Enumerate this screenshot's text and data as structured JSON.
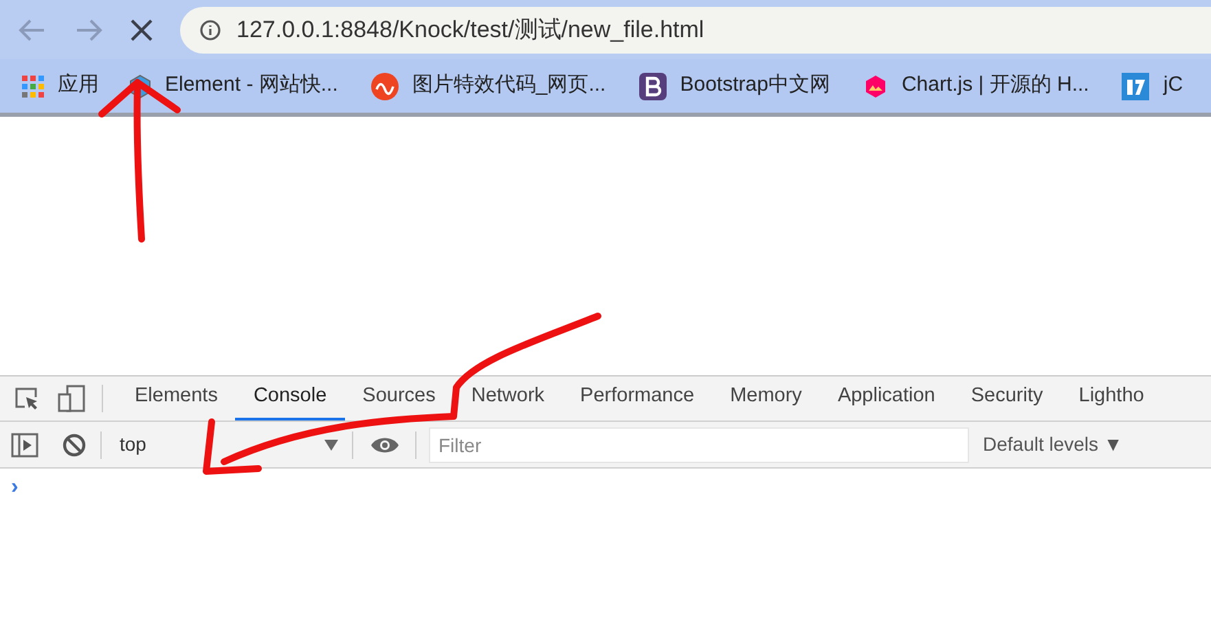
{
  "browser": {
    "url": "127.0.0.1:8848/Knock/test/测试/new_file.html",
    "loading": true
  },
  "bookmarks": [
    {
      "label": "应用"
    },
    {
      "label": "Element - 网站快..."
    },
    {
      "label": "图片特效代码_网页..."
    },
    {
      "label": "Bootstrap中文网"
    },
    {
      "label": "Chart.js | 开源的 H..."
    },
    {
      "label": "jC"
    }
  ],
  "devtools": {
    "tabs": [
      {
        "label": "Elements",
        "selected": false
      },
      {
        "label": "Console",
        "selected": true
      },
      {
        "label": "Sources",
        "selected": false
      },
      {
        "label": "Network",
        "selected": false
      },
      {
        "label": "Performance",
        "selected": false
      },
      {
        "label": "Memory",
        "selected": false
      },
      {
        "label": "Application",
        "selected": false
      },
      {
        "label": "Security",
        "selected": false
      },
      {
        "label": "Lightho",
        "selected": false
      }
    ],
    "context": "top",
    "filter_placeholder": "Filter",
    "levels": "Default levels ▼",
    "prompt": "›"
  }
}
